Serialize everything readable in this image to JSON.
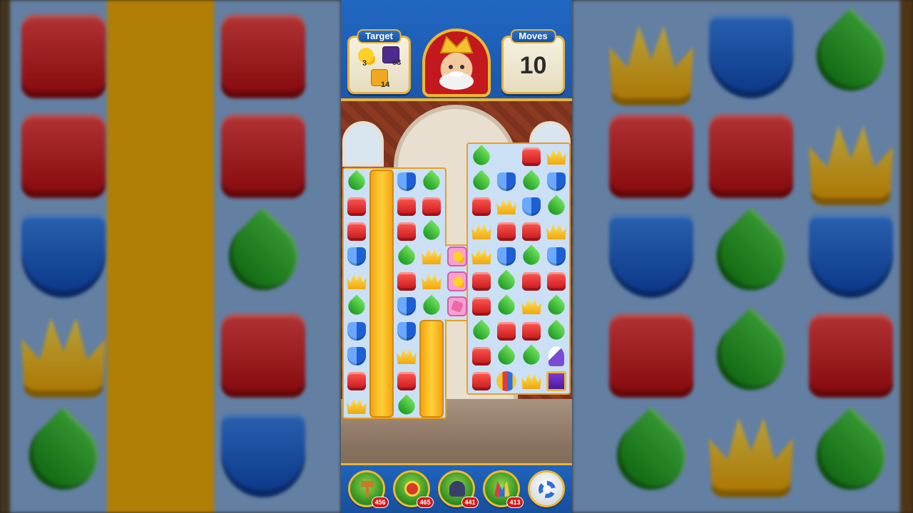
{
  "hud": {
    "target_label": "Target",
    "moves_label": "Moves",
    "moves_value": "10",
    "targets": [
      {
        "icon": "rubber-duck-icon",
        "count": "3"
      },
      {
        "icon": "purple-tile-icon",
        "count": "83"
      },
      {
        "icon": "gold-tile-icon",
        "count": "14"
      }
    ],
    "hero": "king-portrait"
  },
  "boosters": [
    {
      "icon": "hammer-icon",
      "count": "456"
    },
    {
      "icon": "arrow-icon",
      "count": "465"
    },
    {
      "icon": "cannon-icon",
      "count": "441"
    },
    {
      "icon": "jester-hat-icon",
      "count": "413"
    },
    {
      "icon": "gear-icon",
      "count": ""
    }
  ],
  "board_left": [
    [
      "green",
      "bar",
      "blue",
      "green"
    ],
    [
      "red",
      "bar",
      "red",
      "red"
    ],
    [
      "red",
      "bar",
      "red",
      "green"
    ],
    [
      "blue",
      "bar",
      "green",
      "yellow"
    ],
    [
      "yellow",
      "bar",
      "red",
      "yellow"
    ],
    [
      "green",
      "bar",
      "blue",
      "green"
    ],
    [
      "blue",
      "bar",
      "blue",
      "bar"
    ],
    [
      "blue",
      "bar",
      "yellow",
      "bar"
    ],
    [
      "red",
      "bar",
      "red",
      "bar"
    ],
    [
      "yellow",
      "bar",
      "green",
      "bar"
    ]
  ],
  "board_mid": [
    "duck",
    "duck",
    "pink"
  ],
  "board_right": [
    [
      "green",
      "",
      "red",
      "yellow"
    ],
    [
      "green",
      "blue",
      "green",
      "blue"
    ],
    [
      "red",
      "yellow",
      "blue",
      "green"
    ],
    [
      "yellow",
      "red",
      "red",
      "yellow"
    ],
    [
      "yellow",
      "blue",
      "green",
      "blue"
    ],
    [
      "red",
      "green",
      "red",
      "red"
    ],
    [
      "red",
      "green",
      "yellow",
      "green"
    ],
    [
      "green",
      "red",
      "red",
      "green"
    ],
    [
      "red",
      "green",
      "green",
      "rocket"
    ],
    [
      "red",
      "ball",
      "yellow",
      "purple"
    ]
  ],
  "colors": {
    "accent": "#e8b23c",
    "hud_blue": "#1b58ad",
    "board_bg": "#cbe0f5"
  }
}
